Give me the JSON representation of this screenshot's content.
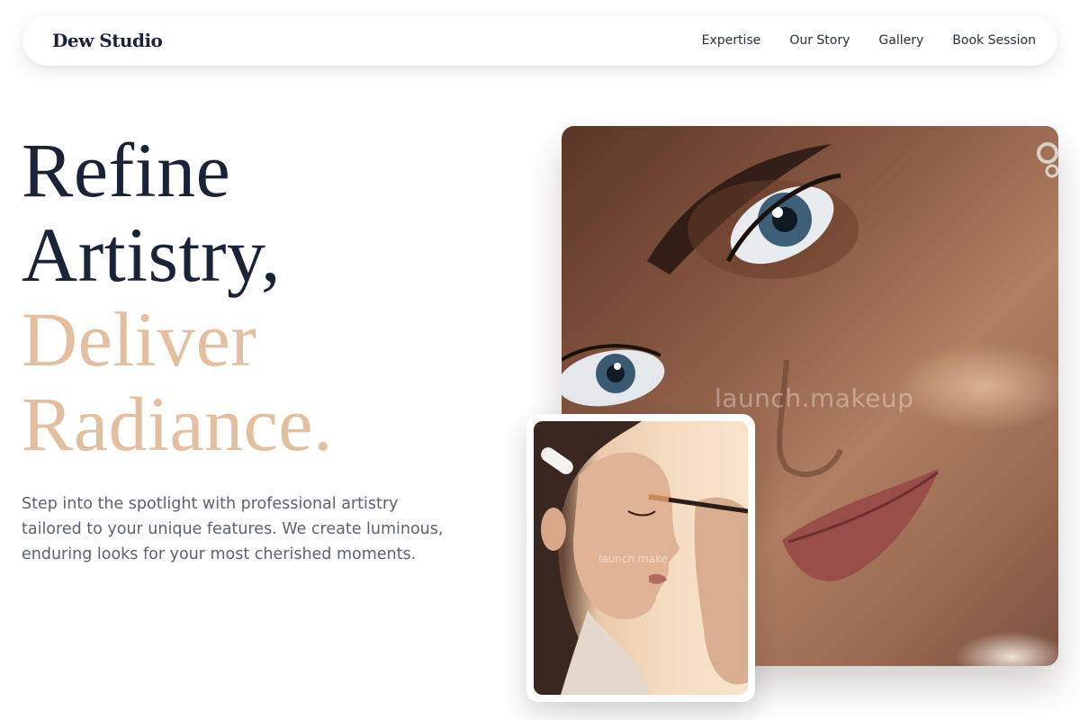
{
  "header": {
    "brand": "Dew Studio",
    "nav": [
      {
        "label": "Expertise"
      },
      {
        "label": "Our Story"
      },
      {
        "label": "Gallery"
      },
      {
        "label": "Book Session"
      }
    ]
  },
  "hero": {
    "headline_lines": [
      {
        "text": "Refine",
        "tone": "dark"
      },
      {
        "text": "Artistry,",
        "tone": "dark"
      },
      {
        "text": "Deliver",
        "tone": "accent"
      },
      {
        "text": "Radiance.",
        "tone": "accent"
      }
    ],
    "description": "Step into the spotlight with professional artistry tailored to your unique features. We create luminous, enduring looks for your most cherished moments."
  },
  "images": {
    "main_watermark": "launch.makeup",
    "inset_watermark": "launch.make"
  },
  "colors": {
    "text_dark": "#1b2437",
    "accent": "#e3bfa0",
    "body_text": "#5b6270",
    "background": "#ffffff"
  }
}
